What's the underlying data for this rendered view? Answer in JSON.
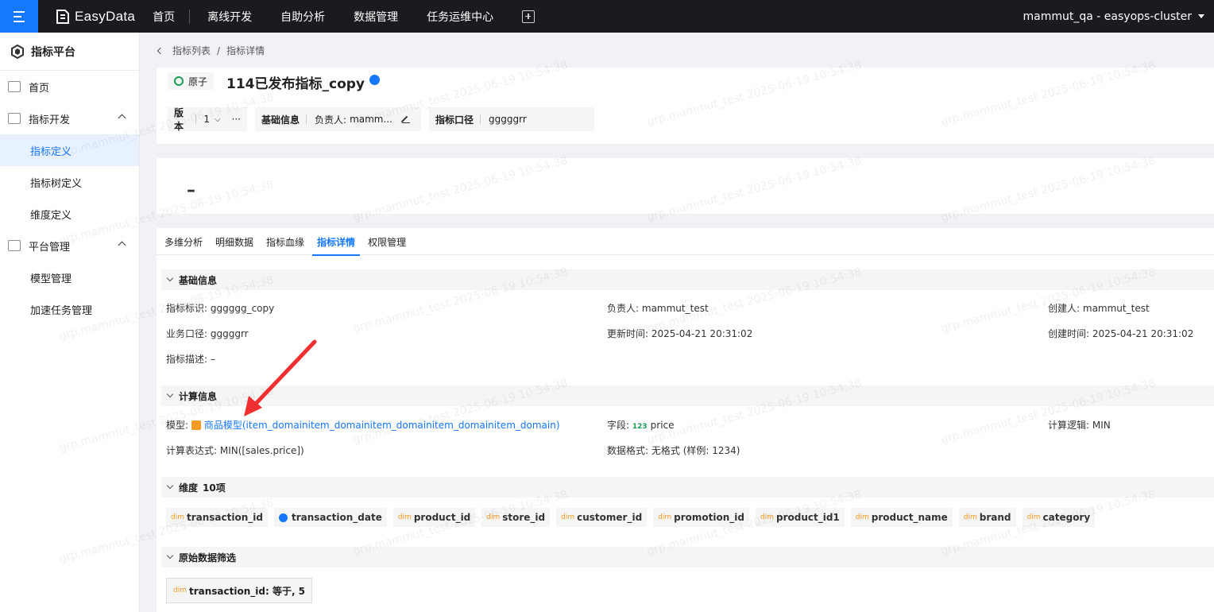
{
  "topbar": {
    "logo_text": "EasyData",
    "nav": [
      "首页",
      "离线开发",
      "自助分析",
      "数据管理",
      "任务运维中心"
    ],
    "user": "mammut_qa - easyops-cluster"
  },
  "sidebar": {
    "title": "指标平台",
    "items": [
      {
        "label": "首页"
      },
      {
        "label": "指标开发"
      },
      {
        "label": "指标定义"
      },
      {
        "label": "指标树定义"
      },
      {
        "label": "维度定义"
      },
      {
        "label": "平台管理"
      },
      {
        "label": "模型管理"
      },
      {
        "label": "加速任务管理"
      }
    ]
  },
  "breadcrumb": {
    "parent": "指标列表",
    "sep": "/",
    "current": "指标详情"
  },
  "header": {
    "type_tag": "原子",
    "title": "114已发布指标_copy",
    "version_label": "版本",
    "version_value": "1",
    "more": "···",
    "basic_label": "基础信息",
    "owner_label": "负责人:",
    "owner_value": "mamm...",
    "caliber_label": "指标口径",
    "caliber_value": "gggggrr"
  },
  "value_card": {
    "value": "–"
  },
  "tabs": [
    "多维分析",
    "明细数据",
    "指标血缘",
    "指标详情",
    "权限管理"
  ],
  "basic": {
    "title": "基础信息",
    "id_label": "指标标识:",
    "id_value": "gggggg_copy",
    "owner_label": "负责人:",
    "owner_value": "mammut_test",
    "creator_label": "创建人:",
    "creator_value": "mammut_test",
    "caliber_label": "业务口径:",
    "caliber_value": "gggggrr",
    "updated_label": "更新时间:",
    "updated_value": "2025-04-21 20:31:02",
    "created_label": "创建时间:",
    "created_value": "2025-04-21 20:31:02",
    "desc_label": "指标描述:",
    "desc_value": "–"
  },
  "calc": {
    "title": "计算信息",
    "model_label": "模型:",
    "model_value": "商品模型(item_domainitem_domainitem_domainitem_domainitem_domain)",
    "field_label": "字段:",
    "field_icon": "123",
    "field_value": "price",
    "logic_label": "计算逻辑:",
    "logic_value": "MIN",
    "expr_label": "计算表达式:",
    "expr_value": "MIN([sales.price])",
    "format_label": "数据格式:",
    "format_value": "无格式 (样例: 1234)"
  },
  "dimensions": {
    "title": "维度",
    "count": "10项",
    "icon_text": "dim",
    "items": [
      "transaction_id",
      "transaction_date",
      "product_id",
      "store_id",
      "customer_id",
      "promotion_id",
      "product_id1",
      "product_name",
      "brand",
      "category"
    ]
  },
  "filter": {
    "title": "原始数据筛选",
    "icon_text": "dim",
    "value": "transaction_id: 等于, 5"
  },
  "watermark": "grp.mammut_test 2025-06-19 10:54:38",
  "colors": {
    "accent": "#1677ff",
    "topbar": "#1a1b1f",
    "annotation_arrow": "#f03030"
  }
}
